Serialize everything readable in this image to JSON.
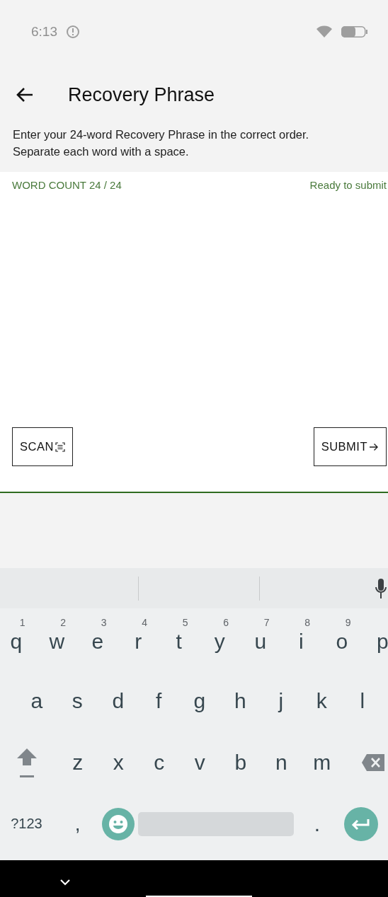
{
  "status_bar": {
    "time": "6:13"
  },
  "header": {
    "title": "Recovery Phrase"
  },
  "instructions": "Enter your 24-word Recovery Phrase in the correct order.\nSeparate each word with a space.",
  "phrase_input": {
    "word_count": "WORD COUNT 24 / 24",
    "status": "Ready to submit"
  },
  "buttons": [
    {
      "label": "SCAN",
      "kind": "scan"
    },
    {
      "label": "SUBMIT",
      "kind": "submit"
    }
  ],
  "keyboard": {
    "rows": [
      [
        {
          "label": "q",
          "hint": "1"
        },
        {
          "label": "w",
          "hint": "2"
        },
        {
          "label": "e",
          "hint": "3"
        },
        {
          "label": "r",
          "hint": "4"
        },
        {
          "label": "t",
          "hint": "5"
        },
        {
          "label": "y",
          "hint": "6"
        },
        {
          "label": "u",
          "hint": "7"
        },
        {
          "label": "i",
          "hint": "8"
        },
        {
          "label": "o",
          "hint": "9"
        },
        {
          "label": "p"
        }
      ],
      [
        {
          "label": "a"
        },
        {
          "label": "s"
        },
        {
          "label": "d"
        },
        {
          "label": "f"
        },
        {
          "label": "g"
        },
        {
          "label": "h"
        },
        {
          "label": "j"
        },
        {
          "label": "k"
        },
        {
          "label": "l"
        }
      ],
      [
        {
          "kind": "shift"
        },
        {
          "label": "z"
        },
        {
          "label": "x"
        },
        {
          "label": "c"
        },
        {
          "label": "v"
        },
        {
          "label": "b"
        },
        {
          "label": "n"
        },
        {
          "label": "m"
        },
        {
          "kind": "backspace"
        }
      ],
      [
        {
          "kind": "symbols",
          "label": "?123"
        },
        {
          "label": ","
        },
        {
          "kind": "emoji"
        },
        {
          "kind": "space"
        },
        {
          "label": "."
        },
        {
          "kind": "enter"
        }
      ]
    ]
  }
}
